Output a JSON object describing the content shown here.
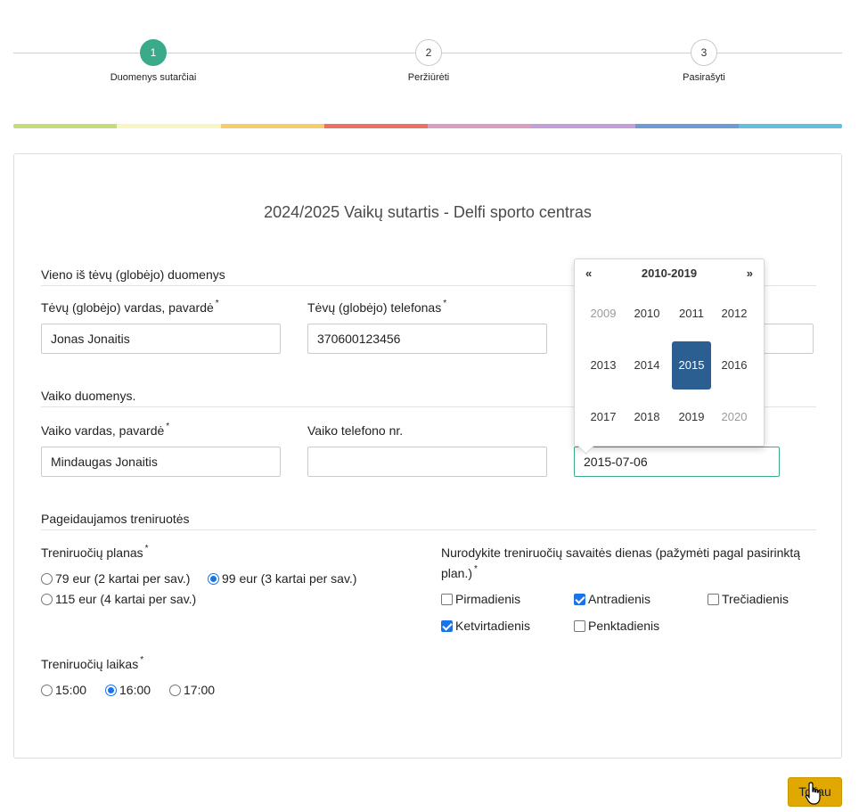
{
  "stepper": {
    "steps": [
      {
        "number": "1",
        "label": "Duomenys sutarčiai"
      },
      {
        "number": "2",
        "label": "Peržiūrėti"
      },
      {
        "number": "3",
        "label": "Pasirašyti"
      }
    ],
    "active_step": 1
  },
  "color_bar": [
    "#c5dc7b",
    "#f7f6c4",
    "#f6cd6a",
    "#ec7163",
    "#d99ec2",
    "#c49fd9",
    "#6d9bd6",
    "#63bfdb"
  ],
  "form": {
    "title": "2024/2025 Vaikų sutartis - Delfi sporto centras",
    "parent_section": {
      "title": "Vieno iš tėvų (globėjo) duomenys",
      "name_label": "Tėvų (globėjo) vardas, pavardė",
      "name_value": "Jonas Jonaitis",
      "phone_label": "Tėvų (globėjo) telefonas",
      "phone_value": "370600123456"
    },
    "child_section": {
      "title": "Vaiko duomenys.",
      "name_label": "Vaiko vardas, pavardė",
      "name_value": "Mindaugas Jonaitis",
      "phone_label": "Vaiko telefono nr.",
      "phone_value": "",
      "birthdate_value": "2015-07-06"
    },
    "training_section": {
      "title": "Pageidaujamos treniruotės",
      "plan_label": "Treniruočių planas",
      "plans": [
        {
          "label": "79 eur (2 kartai per sav.)",
          "checked": false
        },
        {
          "label": "99 eur (3 kartai per sav.)",
          "checked": true
        },
        {
          "label": "115 eur (4 kartai per sav.)",
          "checked": false
        }
      ],
      "days_label_line1": "Nurodykite treniruočių savaitės dienas (pažymėti pagal pasirinktą",
      "days_label_line2": "plan.)",
      "days": [
        {
          "label": "Pirmadienis",
          "checked": false
        },
        {
          "label": "Antradienis",
          "checked": true
        },
        {
          "label": "Trečiadienis",
          "checked": false
        },
        {
          "label": "Ketvirtadienis",
          "checked": true
        },
        {
          "label": "Penktadienis",
          "checked": false
        }
      ],
      "time_label": "Treniruočių laikas",
      "times": [
        {
          "label": "15:00",
          "checked": false
        },
        {
          "label": "16:00",
          "checked": true
        },
        {
          "label": "17:00",
          "checked": false
        }
      ]
    },
    "required_mark": "*"
  },
  "datepicker": {
    "prev": "«",
    "next": "»",
    "range": "2010-2019",
    "years": [
      {
        "label": "2009",
        "muted": true,
        "selected": false
      },
      {
        "label": "2010",
        "muted": false,
        "selected": false
      },
      {
        "label": "2011",
        "muted": false,
        "selected": false
      },
      {
        "label": "2012",
        "muted": false,
        "selected": false
      },
      {
        "label": "2013",
        "muted": false,
        "selected": false
      },
      {
        "label": "2014",
        "muted": false,
        "selected": false
      },
      {
        "label": "2015",
        "muted": false,
        "selected": true
      },
      {
        "label": "2016",
        "muted": false,
        "selected": false
      },
      {
        "label": "2017",
        "muted": false,
        "selected": false
      },
      {
        "label": "2018",
        "muted": false,
        "selected": false
      },
      {
        "label": "2019",
        "muted": false,
        "selected": false
      },
      {
        "label": "2020",
        "muted": true,
        "selected": false
      }
    ]
  },
  "next_button": {
    "label": "Toliau"
  },
  "colors": {
    "accent": "#3aaa8b",
    "selected_year": "#2b5f91",
    "next_button": "#e0a800",
    "check_blue": "#1a73e8"
  }
}
